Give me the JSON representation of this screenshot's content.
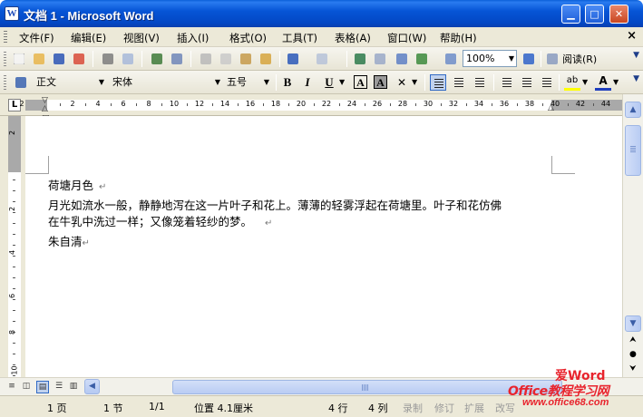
{
  "window": {
    "title": "文档 1 - Microsoft Word",
    "app_icon": "W"
  },
  "window_controls": {
    "minimize": "▁",
    "maximize": "□",
    "close": "✕"
  },
  "menu": {
    "items": [
      "文件(F)",
      "编辑(E)",
      "视图(V)",
      "插入(I)",
      "格式(O)",
      "工具(T)",
      "表格(A)",
      "窗口(W)",
      "帮助(H)"
    ],
    "close_doc": "×"
  },
  "toolbar_standard": {
    "zoom": "100%",
    "read_label": "阅读(R)",
    "icons": [
      "new-icon",
      "open-icon",
      "save-icon",
      "permission-icon",
      "print-icon",
      "print-preview-icon",
      "spelling-icon",
      "research-icon",
      "cut-icon",
      "copy-icon",
      "paste-icon",
      "format-painter-icon",
      "undo-icon",
      "redo-icon",
      "hyperlink-icon",
      "tables-borders-icon",
      "insert-table-icon",
      "insert-excel-icon",
      "columns-icon",
      "drawing-icon",
      "document-map-icon",
      "show-hide-icon",
      "help-icon"
    ]
  },
  "toolbar_format": {
    "style": "正文",
    "font": "宋体",
    "size": "五号",
    "bold": "B",
    "italic": "I",
    "underline": "U",
    "char_border": "A",
    "char_shading": "A",
    "highlight_label": "ab",
    "font_color_label": "A"
  },
  "ruler": {
    "tab_selector": "L",
    "numbers": [
      "2",
      "2",
      "4",
      "6",
      "8",
      "10",
      "12",
      "14",
      "16",
      "18",
      "20",
      "22",
      "24",
      "26",
      "28",
      "30",
      "32",
      "34",
      "36",
      "38",
      "40",
      "42",
      "44"
    ],
    "vertical_numbers": [
      "2",
      "2",
      "4",
      "6",
      "8",
      "10"
    ]
  },
  "document": {
    "paragraphs": [
      "荷塘月色",
      "月光如流水一般，静静地泻在这一片叶子和花上。薄薄的轻雾浮起在荷塘里。叶子和花仿佛",
      "在牛乳中洗过一样；又像笼着轻纱的梦。",
      "朱自清"
    ],
    "paragraph_mark": "↵"
  },
  "statusbar": {
    "page": "1 页",
    "section": "1 节",
    "page_of": "1/1",
    "position": "位置 4.1厘米",
    "line": "4 行",
    "column": "4 列",
    "rec": "录制",
    "trk": "修订",
    "ext": "扩展",
    "ovr": "改写"
  },
  "watermark": {
    "top": "爱Word",
    "mid": "Office教程学习网",
    "bot": "www.office68.com"
  },
  "colors": {
    "title_blue": "#0655d6",
    "chrome": "#ece9d8",
    "watermark_red": "#e8242d"
  }
}
